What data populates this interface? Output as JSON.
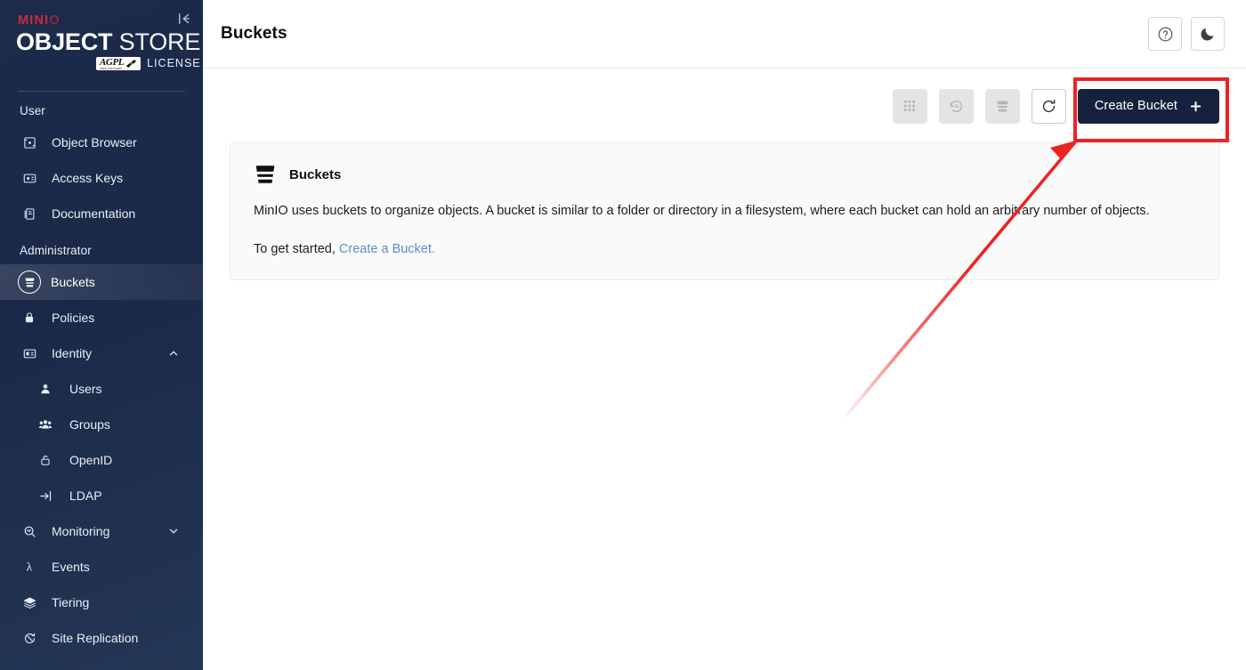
{
  "sidebar": {
    "collapse_icon": "collapse-left-icon",
    "logo": {
      "brand": "MINI",
      "brand_o": "O",
      "line_bold": "OBJECT",
      "line_light": " STORE",
      "badge_text": "AGPL",
      "badge_sub": "FREE SOFTWARE",
      "badge_version": "v3",
      "license_text": "LICENSE"
    },
    "sections": [
      {
        "label": "User",
        "items": [
          {
            "label": "Object Browser",
            "icon": "object-browser-icon",
            "active": false,
            "sub": false
          },
          {
            "label": "Access Keys",
            "icon": "access-keys-icon",
            "active": false,
            "sub": false
          },
          {
            "label": "Documentation",
            "icon": "documentation-icon",
            "active": false,
            "sub": false
          }
        ]
      },
      {
        "label": "Administrator",
        "items": [
          {
            "label": "Buckets",
            "icon": "bucket-icon",
            "active": true,
            "sub": false
          },
          {
            "label": "Policies",
            "icon": "lock-icon",
            "active": false,
            "sub": false
          },
          {
            "label": "Identity",
            "icon": "identity-icon",
            "active": false,
            "sub": false,
            "chevron": "chevron-up-icon"
          },
          {
            "label": "Users",
            "icon": "user-icon",
            "active": false,
            "sub": true
          },
          {
            "label": "Groups",
            "icon": "groups-icon",
            "active": false,
            "sub": true
          },
          {
            "label": "OpenID",
            "icon": "openid-lock-icon",
            "active": false,
            "sub": true
          },
          {
            "label": "LDAP",
            "icon": "ldap-login-icon",
            "active": false,
            "sub": true
          },
          {
            "label": "Monitoring",
            "icon": "monitoring-search-icon",
            "active": false,
            "sub": false,
            "chevron": "chevron-down-icon"
          },
          {
            "label": "Events",
            "icon": "lambda-icon",
            "active": false,
            "sub": false
          },
          {
            "label": "Tiering",
            "icon": "tiering-layers-icon",
            "active": false,
            "sub": false
          },
          {
            "label": "Site Replication",
            "icon": "site-replication-icon",
            "active": false,
            "sub": false
          }
        ]
      }
    ]
  },
  "topbar": {
    "title": "Buckets",
    "help_icon": "help-circle-icon",
    "theme_icon": "moon-icon"
  },
  "toolbar": {
    "buttons": [
      {
        "name": "grid-view-button",
        "icon": "grid-icon",
        "enabled": false
      },
      {
        "name": "lifecycle-button",
        "icon": "rewind-icon",
        "enabled": false
      },
      {
        "name": "delete-bucket-button",
        "icon": "delete-bucket-icon",
        "enabled": false
      },
      {
        "name": "refresh-button",
        "icon": "refresh-icon",
        "enabled": true
      }
    ],
    "create_label": "Create Bucket",
    "create_icon": "plus-icon"
  },
  "info_panel": {
    "icon": "bucket-icon",
    "title": "Buckets",
    "body": "MinIO uses buckets to organize objects. A bucket is similar to a folder or directory in a filesystem, where each bucket can hold an arbitrary number of objects.",
    "footer_prefix": "To get started, ",
    "footer_link": "Create a Bucket."
  },
  "annotation": {
    "highlight_color": "#ee2222",
    "arrow_color": "#ee2222"
  },
  "colors": {
    "sidebar_bg": "#1b2948",
    "accent_red": "#c72c41",
    "primary_dark": "#16213d",
    "link_blue": "#5b8dc9"
  }
}
